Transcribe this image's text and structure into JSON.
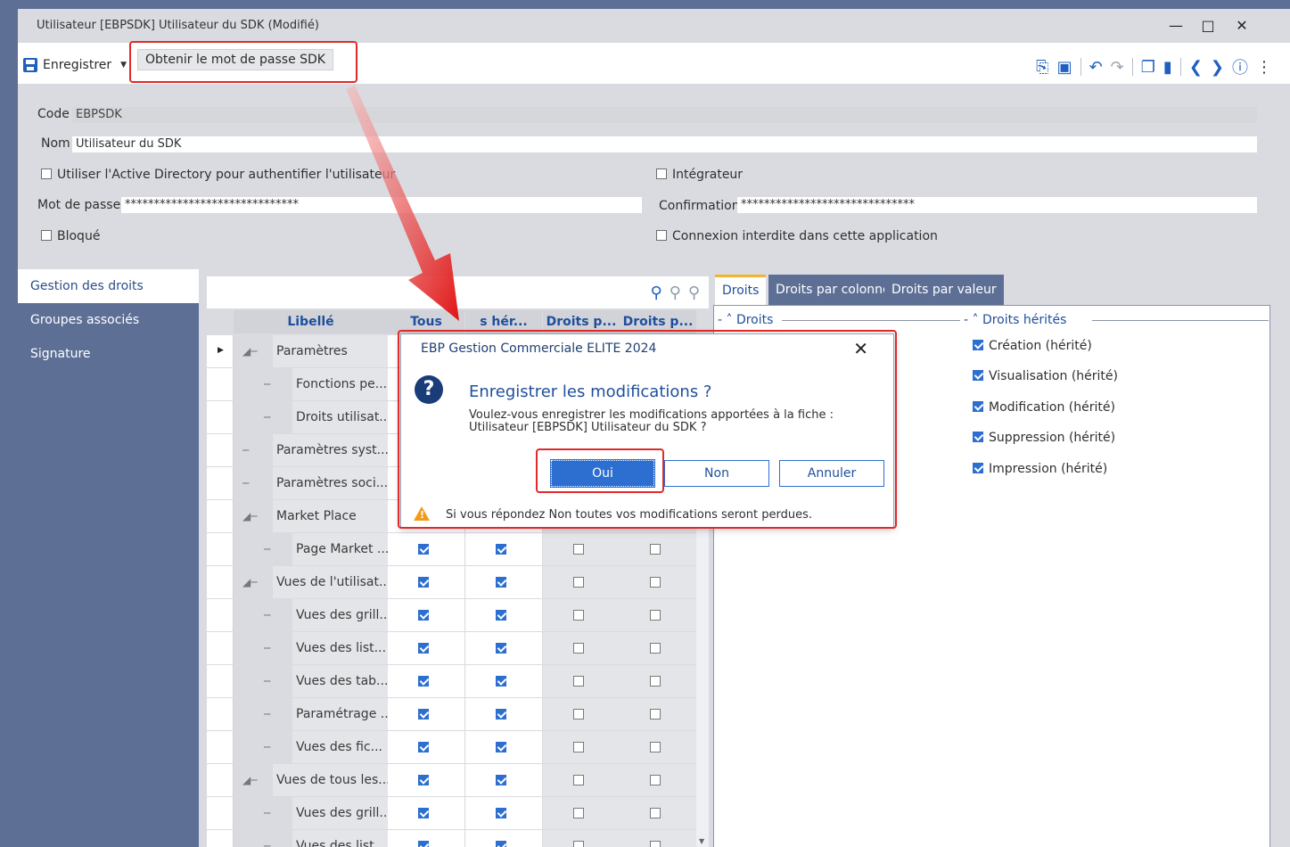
{
  "window": {
    "title": "Utilisateur [EBPSDK] Utilisateur du SDK (Modifié)"
  },
  "toolbar": {
    "save_label": "Enregistrer",
    "get_password_label": "Obtenir le mot de passe SDK"
  },
  "form": {
    "code_label": "Code",
    "code_value": "EBPSDK",
    "nom_label": "Nom",
    "nom_value": "Utilisateur du SDK",
    "active_directory_label": "Utiliser l'Active Directory pour authentifier l'utilisateur",
    "integrateur_label": "Intégrateur",
    "password_label": "Mot de passe",
    "password_value": "******************************",
    "confirmation_label": "Confirmation",
    "confirmation_value": "******************************",
    "bloque_label": "Bloqué",
    "connexion_label": "Connexion interdite dans cette application"
  },
  "sidebar": {
    "items": [
      {
        "label": "Gestion des droits"
      },
      {
        "label": "Groupes associés"
      },
      {
        "label": "Signature"
      }
    ]
  },
  "tree": {
    "headers": [
      "Libellé",
      "Tous",
      "Droits hérités",
      "Droits p...",
      "Droits p..."
    ],
    "header_labels": [
      "Libellé",
      "Tous",
      "s hér...",
      "Droits p...",
      "Droits p..."
    ],
    "rows": [
      {
        "label": "Paramètres",
        "level": 0,
        "tous": null,
        "herites": null,
        "dp1": null,
        "dp2": null
      },
      {
        "label": "Fonctions pe...",
        "level": 1,
        "tous": null,
        "herites": null,
        "dp1": null,
        "dp2": null
      },
      {
        "label": "Droits utilisat...",
        "level": 1,
        "tous": null,
        "herites": null,
        "dp1": null,
        "dp2": null
      },
      {
        "label": "Paramètres syst...",
        "level": 0,
        "tous": null,
        "herites": null,
        "dp1": null,
        "dp2": null
      },
      {
        "label": "Paramètres soci...",
        "level": 0,
        "tous": null,
        "herites": null,
        "dp1": null,
        "dp2": null
      },
      {
        "label": "Market Place",
        "level": 0,
        "tous": null,
        "herites": null,
        "dp1": null,
        "dp2": null
      },
      {
        "label": "Page Market ...",
        "level": 1,
        "tous": true,
        "herites": true,
        "dp1": false,
        "dp2": false
      },
      {
        "label": "Vues de l'utilisat...",
        "level": 0,
        "tous": true,
        "herites": true,
        "dp1": false,
        "dp2": false
      },
      {
        "label": "Vues des grill...",
        "level": 1,
        "tous": true,
        "herites": true,
        "dp1": false,
        "dp2": false
      },
      {
        "label": "Vues des list...",
        "level": 1,
        "tous": true,
        "herites": true,
        "dp1": false,
        "dp2": false
      },
      {
        "label": "Vues des tab...",
        "level": 1,
        "tous": true,
        "herites": true,
        "dp1": false,
        "dp2": false
      },
      {
        "label": "Paramétrage ...",
        "level": 1,
        "tous": true,
        "herites": true,
        "dp1": false,
        "dp2": false
      },
      {
        "label": "Vues des fic...",
        "level": 1,
        "tous": true,
        "herites": true,
        "dp1": false,
        "dp2": false
      },
      {
        "label": "Vues de tous les...",
        "level": 0,
        "tous": true,
        "herites": true,
        "dp1": false,
        "dp2": false
      },
      {
        "label": "Vues des grill...",
        "level": 1,
        "tous": true,
        "herites": true,
        "dp1": false,
        "dp2": false
      },
      {
        "label": "Vues des list",
        "level": 1,
        "tous": true,
        "herites": true,
        "dp1": false,
        "dp2": false
      }
    ]
  },
  "rights": {
    "tabs": [
      {
        "label": "Droits"
      },
      {
        "label": "Droits par colonne"
      },
      {
        "label": "Droits par valeur"
      }
    ],
    "droits_group": "Droits",
    "herites_group": "Droits hérités",
    "inherited": [
      "Création (hérité)",
      "Visualisation (hérité)",
      "Modification (hérité)",
      "Suppression (hérité)",
      "Impression (hérité)"
    ]
  },
  "dialog": {
    "title": "EBP Gestion Commerciale ELITE 2024",
    "heading": "Enregistrer les modifications ?",
    "message_line1": "Voulez-vous enregistrer les modifications apportées à la fiche :",
    "message_line2": "Utilisateur [EBPSDK] Utilisateur du SDK ?",
    "yes": "Oui",
    "no": "Non",
    "cancel": "Annuler",
    "warning": "Si vous répondez Non toutes vos modifications seront perdues."
  },
  "colors": {
    "accent": "#1f5fbf",
    "sidebar": "#5d6f95",
    "highlight": "#e02a2a",
    "warning": "#f29b18"
  }
}
